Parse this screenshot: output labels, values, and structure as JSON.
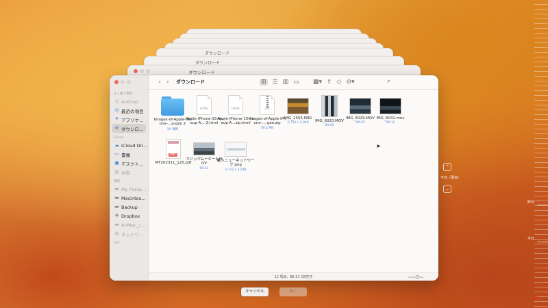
{
  "window": {
    "title": "ダウンロード",
    "status": "12 項目、86.31 GB空き"
  },
  "toolbar": {
    "back": "‹",
    "forward": "›",
    "view_icons": [
      "icon-view-icon",
      "list-view-icon",
      "column-view-icon",
      "gallery-view-icon"
    ]
  },
  "sidebar": {
    "sections": [
      {
        "label": "よく使う項目",
        "items": [
          {
            "label": "AirDrop",
            "icon": "airdrop-icon",
            "dim": true
          },
          {
            "label": "最近の項目",
            "icon": "clock-icon",
            "dim": false
          },
          {
            "label": "アプリケ…",
            "icon": "apps-icon",
            "dim": false
          },
          {
            "label": "ダウンロ…",
            "icon": "download-icon",
            "dim": false,
            "selected": true
          }
        ]
      },
      {
        "label": "iCloud",
        "items": [
          {
            "label": "iCloud Dri…",
            "icon": "cloud-icon",
            "dim": false
          },
          {
            "label": "書類",
            "icon": "document-icon",
            "dim": false
          },
          {
            "label": "デスクト…",
            "icon": "desktop-icon",
            "dim": false
          },
          {
            "label": "共有",
            "icon": "shared-icon",
            "dim": true
          }
        ]
      },
      {
        "label": "場所",
        "items": [
          {
            "label": "My Passp…",
            "icon": "drive-icon",
            "dim": true
          },
          {
            "label": "Macintos…",
            "icon": "drive-icon",
            "dim": false
          },
          {
            "label": "Backup",
            "icon": "drive-icon",
            "dim": false
          },
          {
            "label": "Dropbox",
            "icon": "dropbox-icon",
            "dim": false
          },
          {
            "label": "AirMac_c…",
            "icon": "drive-icon",
            "dim": true
          },
          {
            "label": "ネットワ…",
            "icon": "network-icon",
            "dim": true
          }
        ]
      },
      {
        "label": "タグ",
        "items": []
      }
    ]
  },
  "files": [
    {
      "name": "Images-of-Apple-iPhone-...p-geo 2",
      "meta": "20 項目",
      "kind": "folder"
    },
    {
      "name": "Apple-iPhone-15-lineup-A...-2.html",
      "meta": "",
      "kind": "html"
    },
    {
      "name": "Apple-iPhone-15-lineup-A...zip.html",
      "meta": "",
      "kind": "html"
    },
    {
      "name": "Images-of-Apple-iPhone-...-geo.zip",
      "meta": "59.2 MB",
      "kind": "zip"
    },
    {
      "name": "IMG_2555.PNG",
      "meta": "2,732 x 2,048",
      "kind": "photo",
      "variant": "ph1"
    },
    {
      "name": "IMG_6020.MOV",
      "meta": "00:25",
      "kind": "photo",
      "variant": "ph2"
    },
    {
      "name": "IMG_6029.MOV",
      "meta": "00:25",
      "kind": "photo",
      "variant": "ph3"
    },
    {
      "name": "IMG_6041.mov",
      "meta": "00:12",
      "kind": "photo",
      "variant": "ph4"
    },
    {
      "name": "MF202311_125.pdf",
      "meta": "",
      "kind": "pdf"
    },
    {
      "name": "マジックムービー1.MOV",
      "meta": "00:23",
      "kind": "photo",
      "variant": "ph5"
    },
    {
      "name": "裏メニューネットワーク.png",
      "meta": "2,732 x 2,048",
      "kind": "photo",
      "variant": "ph6"
    }
  ],
  "buttons": {
    "cancel": "キャンセル",
    "open": "開く"
  },
  "timeline": {
    "today_label": "今日（現在）",
    "marks": [
      "昨日",
      "今日"
    ]
  },
  "colors": {
    "accent": "#3b82d6",
    "close": "#ee6a5f"
  }
}
